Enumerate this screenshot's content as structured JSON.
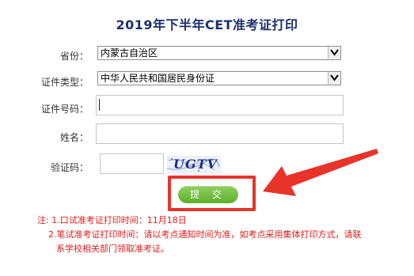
{
  "page": {
    "title": "2019年下半年CET准考证打印"
  },
  "form": {
    "province": {
      "label": "省份：",
      "value": "内蒙古自治区"
    },
    "id_type": {
      "label": "证件类型：",
      "value": "中华人民共和国居民身份证"
    },
    "id_number": {
      "label": "证件号码：",
      "value": ""
    },
    "name": {
      "label": "姓名：",
      "value": ""
    },
    "captcha": {
      "label": "验证码：",
      "input_value": "",
      "image_text": "UGTV"
    },
    "submit_label": "提 交"
  },
  "notes": {
    "line1": "注: 1.口试准考证打印时间：11月18日",
    "line2": "2.笔试准考证打印时间：请以考点通知时间为准，如考点采用集体打印方式，请联",
    "line3": "系学校相关部门领取准考证。"
  },
  "annotation": {
    "highlight_color": "#e8332b"
  },
  "icons": {
    "dropdown": "chevron-down-icon",
    "pointer": "red-arrow-icon"
  }
}
